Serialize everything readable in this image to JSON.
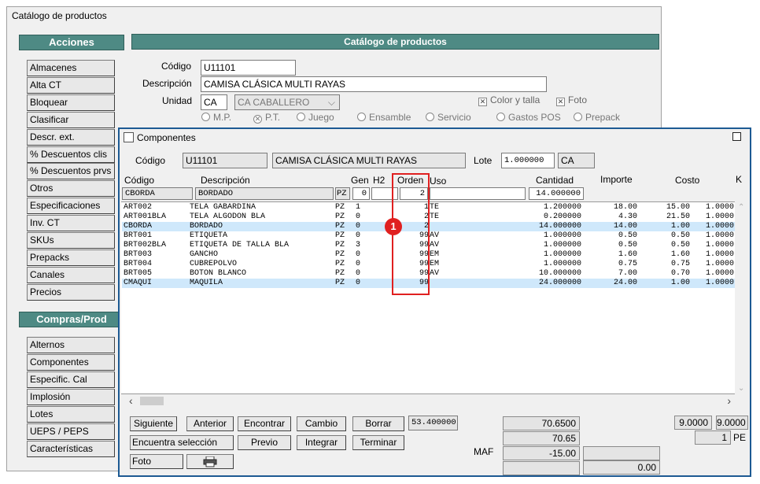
{
  "main_window": {
    "title": "Catálogo de productos",
    "acciones_header": "Acciones",
    "catalogo_header": "Catálogo de productos",
    "compras_header": "Compras/Prod",
    "acciones_items": [
      "Almacenes",
      "Alta CT",
      "Bloquear",
      "Clasificar",
      "Descr. ext.",
      "% Descuentos clis",
      "% Descuentos prvs",
      "Otros",
      "Especificaciones",
      "Inv. CT",
      "SKUs",
      "Prepacks",
      "Canales",
      "Precios"
    ],
    "compras_items": [
      "Alternos",
      "Componentes",
      "Especific. Cal",
      "Implosión",
      "Lotes",
      "UEPS / PEPS",
      "Características"
    ],
    "form": {
      "codigo_label": "Código",
      "codigo_value": "U11101",
      "descripcion_label": "Descripción",
      "descripcion_value": "CAMISA CLÁSICA MULTI RAYAS",
      "unidad_label": "Unidad",
      "unidad_value": "CA",
      "unidad_select": "CA  CABALLERO",
      "color_talla": "Color y talla",
      "foto": "Foto",
      "radios": [
        "M.P.",
        "P.T.",
        "Juego",
        "Ensamble",
        "Servicio",
        "Gastos POS",
        "Prepack"
      ]
    }
  },
  "dialog": {
    "title": "Componentes",
    "codigo_label": "Código",
    "codigo_value": "U11101",
    "descripcion_value": "CAMISA CLÁSICA MULTI RAYAS",
    "lote_label": "Lote",
    "lote_value": "1.000000",
    "lote_unit": "CA",
    "columns": [
      "Código",
      "Descripción",
      "Gen",
      "H2",
      "Orden",
      "Uso",
      "Cantidad",
      "Importe",
      "Costo",
      "K"
    ],
    "edit_row": {
      "codigo": "CBORDA",
      "descripcion": "BORDADO",
      "unidad": "PZ",
      "gen": "0",
      "orden": "2",
      "cantidad": "14.000000"
    },
    "rows": [
      {
        "codigo": "ART002",
        "descripcion": "TELA GABARDINA",
        "u": "PZ",
        "gen": "1",
        "orden": "1",
        "uso": "TE",
        "cantidad": "1.200000",
        "importe": "18.00",
        "costo": "15.00",
        "k": "1.0000"
      },
      {
        "codigo": "ART001BLA",
        "descripcion": "TELA ALGODON BLA",
        "u": "PZ",
        "gen": "0",
        "orden": "2",
        "uso": "TE",
        "cantidad": "0.200000",
        "importe": "4.30",
        "costo": "21.50",
        "k": "1.0000"
      },
      {
        "codigo": "CBORDA",
        "descripcion": "BORDADO",
        "u": "PZ",
        "gen": "0",
        "orden": "2",
        "uso": "",
        "cantidad": "14.000000",
        "importe": "14.00",
        "costo": "1.00",
        "k": "1.0000"
      },
      {
        "codigo": "BRT001",
        "descripcion": "ETIQUETA",
        "u": "PZ",
        "gen": "0",
        "orden": "99",
        "uso": "AV",
        "cantidad": "1.000000",
        "importe": "0.50",
        "costo": "0.50",
        "k": "1.0000"
      },
      {
        "codigo": "BRT002BLA",
        "descripcion": "ETIQUETA DE TALLA BLA",
        "u": "PZ",
        "gen": "3",
        "orden": "99",
        "uso": "AV",
        "cantidad": "1.000000",
        "importe": "0.50",
        "costo": "0.50",
        "k": "1.0000"
      },
      {
        "codigo": "BRT003",
        "descripcion": "GANCHO",
        "u": "PZ",
        "gen": "0",
        "orden": "99",
        "uso": "EM",
        "cantidad": "1.000000",
        "importe": "1.60",
        "costo": "1.60",
        "k": "1.0000"
      },
      {
        "codigo": "BRT004",
        "descripcion": "CUBREPOLVO",
        "u": "PZ",
        "gen": "0",
        "orden": "99",
        "uso": "EM",
        "cantidad": "1.000000",
        "importe": "0.75",
        "costo": "0.75",
        "k": "1.0000"
      },
      {
        "codigo": "BRT005",
        "descripcion": "BOTON BLANCO",
        "u": "PZ",
        "gen": "0",
        "orden": "99",
        "uso": "AV",
        "cantidad": "10.000000",
        "importe": "7.00",
        "costo": "0.70",
        "k": "1.0000"
      },
      {
        "codigo": "CMAQUI",
        "descripcion": "MAQUILA",
        "u": "PZ",
        "gen": "0",
        "orden": "99",
        "uso": "",
        "cantidad": "24.000000",
        "importe": "24.00",
        "costo": "1.00",
        "k": "1.0000"
      }
    ],
    "buttons": {
      "siguiente": "Siguiente",
      "anterior": "Anterior",
      "encontrar": "Encontrar",
      "cambio": "Cambio",
      "borrar": "Borrar",
      "encuentra_seleccion": "Encuentra selección",
      "previo": "Previo",
      "integrar": "Integrar",
      "terminar": "Terminar",
      "foto": "Foto"
    },
    "value_53": "53.400000",
    "totals": {
      "t1": "70.6500",
      "t2": "70.65",
      "t3": "-15.00",
      "t4": "0.00",
      "maf_label": "MAF",
      "r1": "9.0000",
      "r2": "9.0000",
      "r3": "1",
      "pe": "PE"
    },
    "annotation_number": "1"
  }
}
